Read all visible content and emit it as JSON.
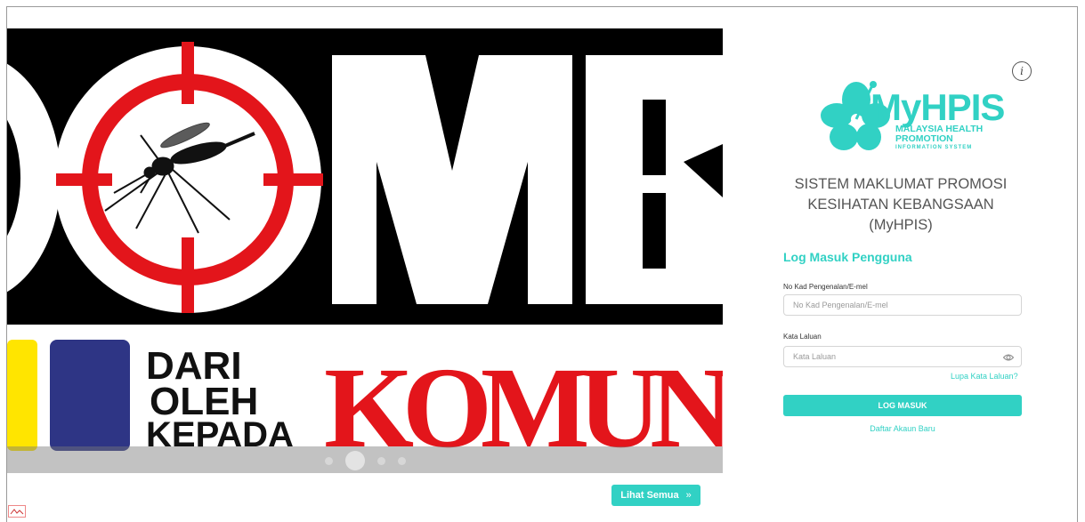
{
  "banner": {
    "top_text": "OMB",
    "line1": "DARI",
    "line2": "OLEH",
    "line3": "KEPADA",
    "big_word": "KOMUN",
    "slides": 4,
    "active_slide": 2
  },
  "view_all": {
    "label": "Lihat Semua",
    "chevron": "»"
  },
  "logo": {
    "name": "MyHPIS",
    "line1": "MALAYSIA HEALTH",
    "line2": "PROMOTION",
    "line3": "INFORMATION SYSTEM"
  },
  "system_title": [
    "SISTEM MAKLUMAT PROMOSI",
    "KESIHATAN KEBANGSAAN",
    "(MyHPIS)"
  ],
  "login": {
    "heading": "Log Masuk Pengguna",
    "id_label": "No Kad Pengenalan/E-mel",
    "id_placeholder": "No Kad Pengenalan/E-mel",
    "password_label": "Kata Laluan",
    "password_placeholder": "Kata Laluan",
    "forgot": "Lupa Kata Laluan?",
    "submit": "LOG MASUK",
    "register": "Daftar Akaun Baru"
  },
  "icons": {
    "info": "info-icon",
    "eye": "eye-icon",
    "flower": "hibiscus-icon"
  },
  "colors": {
    "accent": "#31d1c4",
    "red": "#e3151b",
    "navy": "#2e3585",
    "yellow": "#ffe500"
  }
}
